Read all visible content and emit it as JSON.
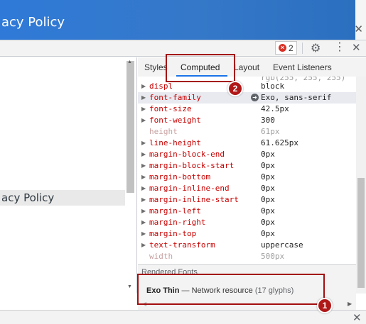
{
  "page": {
    "banner_title": "acy Policy"
  },
  "toolbar": {
    "error_count": "2",
    "gear_icon": "gear-icon",
    "kebab_icon": "kebab-icon",
    "close_glyph": "✕"
  },
  "tabs": [
    {
      "label": "Styles"
    },
    {
      "label": "Computed"
    },
    {
      "label": "Layout"
    },
    {
      "label": "Event Listeners"
    }
  ],
  "properties": [
    {
      "name": "displ",
      "value": "block",
      "inherited": false,
      "expandable": true
    },
    {
      "name": "font-family",
      "value": "Exo, sans-serif",
      "inherited": false,
      "expandable": true,
      "highlighted": true
    },
    {
      "name": "font-size",
      "value": "42.5px",
      "inherited": false,
      "expandable": true
    },
    {
      "name": "font-weight",
      "value": "300",
      "inherited": false,
      "expandable": true
    },
    {
      "name": "height",
      "value": "61px",
      "inherited": true,
      "expandable": false
    },
    {
      "name": "line-height",
      "value": "61.625px",
      "inherited": false,
      "expandable": true
    },
    {
      "name": "margin-block-end",
      "value": "0px",
      "inherited": false,
      "expandable": true
    },
    {
      "name": "margin-block-start",
      "value": "0px",
      "inherited": false,
      "expandable": true
    },
    {
      "name": "margin-bottom",
      "value": "0px",
      "inherited": false,
      "expandable": true
    },
    {
      "name": "margin-inline-end",
      "value": "0px",
      "inherited": false,
      "expandable": true
    },
    {
      "name": "margin-inline-start",
      "value": "0px",
      "inherited": false,
      "expandable": true
    },
    {
      "name": "margin-left",
      "value": "0px",
      "inherited": false,
      "expandable": true
    },
    {
      "name": "margin-right",
      "value": "0px",
      "inherited": false,
      "expandable": true
    },
    {
      "name": "margin-top",
      "value": "0px",
      "inherited": false,
      "expandable": true
    },
    {
      "name": "text-transform",
      "value": "uppercase",
      "inherited": false,
      "expandable": true
    },
    {
      "name": "width",
      "value": "500px",
      "inherited": true,
      "expandable": false
    }
  ],
  "rendered_fonts": {
    "heading": "Rendered Fonts",
    "font_name": "Exo Thin",
    "dash": "—",
    "source": "Network resource",
    "glyphs": "(17 glyphs)"
  },
  "annotations": [
    {
      "label": "1"
    },
    {
      "label": "2"
    }
  ],
  "left_pane": {
    "selected_text": "acy Policy"
  }
}
